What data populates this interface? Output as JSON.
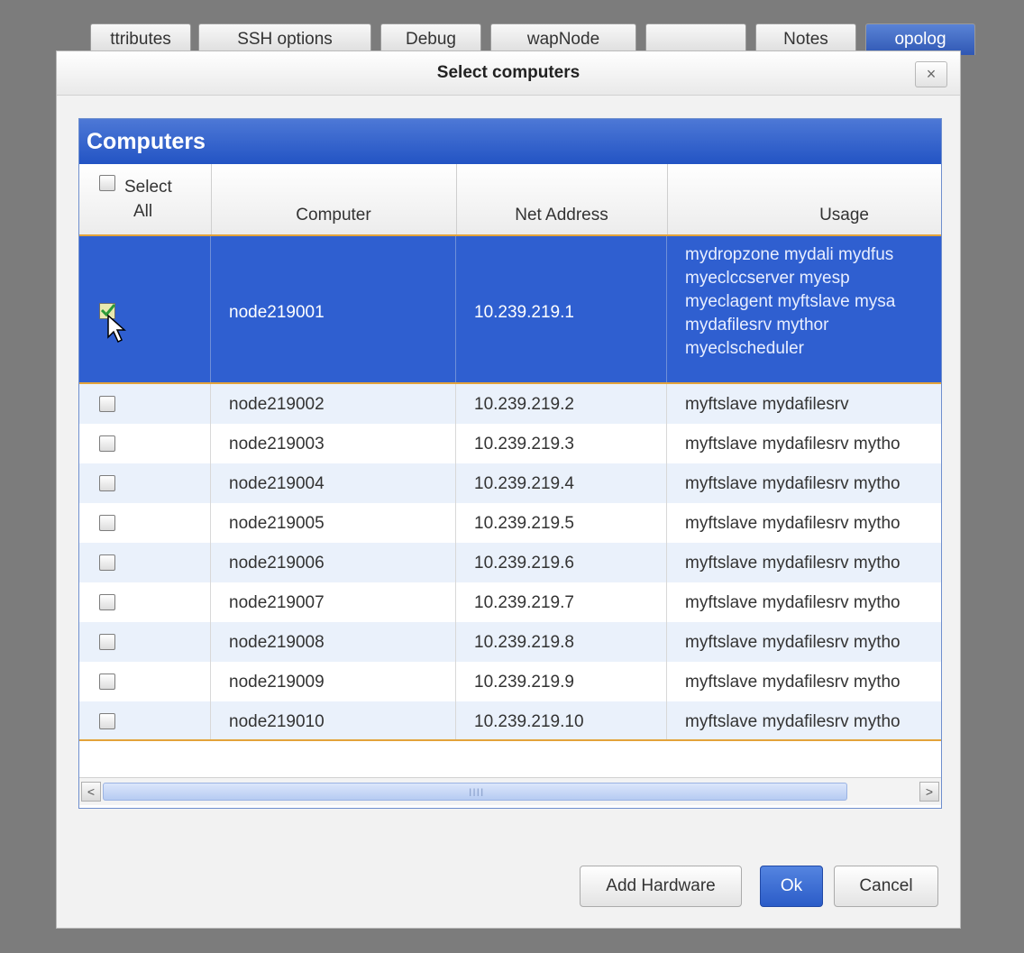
{
  "background_tabs": [
    {
      "label": "ttributes"
    },
    {
      "label": "SSH options"
    },
    {
      "label": "Debug"
    },
    {
      "label": "wapNode"
    },
    {
      "label": ""
    },
    {
      "label": "Notes"
    },
    {
      "label": "opolog"
    }
  ],
  "dialog": {
    "title": "Select computers",
    "close_label": "×"
  },
  "panel": {
    "title": "Computers",
    "select_all_line1": "Select",
    "select_all_line2": "All",
    "columns": {
      "computer": "Computer",
      "net_address": "Net Address",
      "usage": "Usage"
    }
  },
  "rows": [
    {
      "checked": true,
      "selected": true,
      "computer": "node219001",
      "net_address": "10.239.219.1",
      "usage_lines": [
        "mydropzone mydali mydfus",
        "myeclccserver myesp",
        "myeclagent myftslave mysa",
        "mydafilesrv mythor",
        "myeclscheduler"
      ]
    },
    {
      "checked": false,
      "computer": "node219002",
      "net_address": "10.239.219.2",
      "usage": "myftslave mydafilesrv"
    },
    {
      "checked": false,
      "computer": "node219003",
      "net_address": "10.239.219.3",
      "usage": "myftslave mydafilesrv mytho"
    },
    {
      "checked": false,
      "computer": "node219004",
      "net_address": "10.239.219.4",
      "usage": "myftslave mydafilesrv mytho"
    },
    {
      "checked": false,
      "computer": "node219005",
      "net_address": "10.239.219.5",
      "usage": "myftslave mydafilesrv mytho"
    },
    {
      "checked": false,
      "computer": "node219006",
      "net_address": "10.239.219.6",
      "usage": "myftslave mydafilesrv mytho"
    },
    {
      "checked": false,
      "computer": "node219007",
      "net_address": "10.239.219.7",
      "usage": "myftslave mydafilesrv mytho"
    },
    {
      "checked": false,
      "computer": "node219008",
      "net_address": "10.239.219.8",
      "usage": "myftslave mydafilesrv mytho"
    },
    {
      "checked": false,
      "computer": "node219009",
      "net_address": "10.239.219.9",
      "usage": "myftslave mydafilesrv mytho"
    },
    {
      "checked": false,
      "computer": "node219010",
      "net_address": "10.239.219.10",
      "usage": "myftslave mydafilesrv mytho"
    }
  ],
  "scrollbar": {
    "left_arrow": "<",
    "right_arrow": ">",
    "grip": "IIII"
  },
  "buttons": {
    "add_hardware": "Add Hardware",
    "ok": "Ok",
    "cancel": "Cancel"
  },
  "colors": {
    "accent": "#2f5fd0",
    "selection_border": "#e3a33a",
    "frame": "#8a8a8a"
  }
}
